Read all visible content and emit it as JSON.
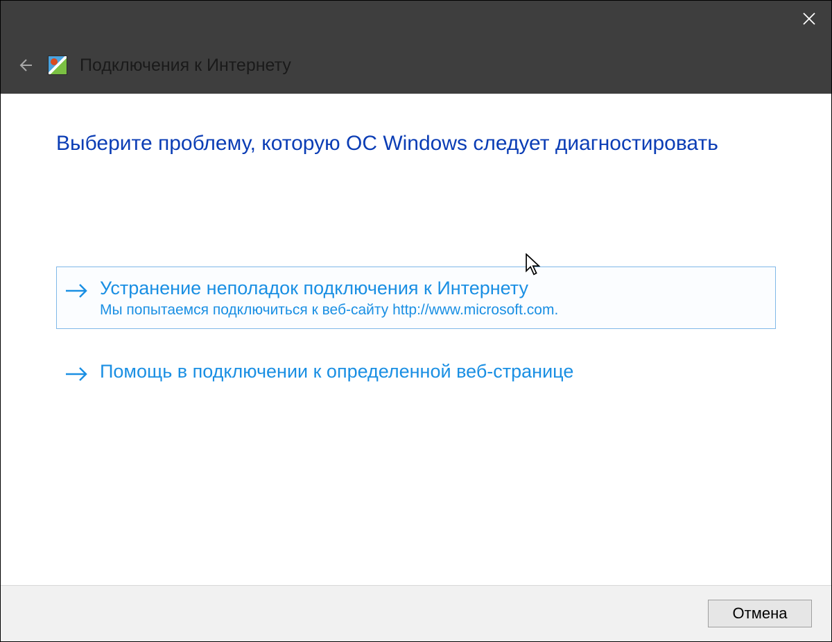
{
  "header": {
    "title": "Подключения к Интернету"
  },
  "content": {
    "heading": "Выберите проблему, которую ОС Windows следует диагностировать"
  },
  "options": [
    {
      "title": "Устранение неполадок подключения к Интернету",
      "desc": "Мы попытаемся подключиться к веб-сайту http://www.microsoft.com."
    },
    {
      "title": "Помощь в подключении к определенной веб-странице",
      "desc": ""
    }
  ],
  "footer": {
    "cancel": "Отмена"
  }
}
